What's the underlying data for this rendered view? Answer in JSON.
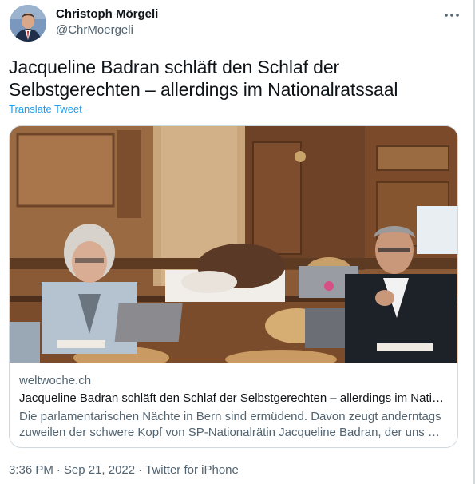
{
  "author": {
    "display_name": "Christoph Mörgeli",
    "handle": "@ChrMoergeli"
  },
  "tweet": {
    "text": "Jacqueline Badran schläft den Schlaf der Selbstgerechten – allerdings im Nationalratssaal",
    "translate_label": "Translate Tweet"
  },
  "card": {
    "domain": "weltwoche.ch",
    "title": "Jacqueline Badran schläft den Schlaf der Selbstgerechten – allerdings im Natio…",
    "description": "Die parlamentarischen Nächte in Bern sind ermüdend. Davon zeugt anderntags zuweilen der schwere Kopf von SP-Nationalrätin Jacqueline Badran, der uns …"
  },
  "meta": {
    "time": "3:36 PM",
    "separator": "·",
    "date": "Sep 21, 2022",
    "source": "Twitter for iPhone"
  },
  "icons": {
    "more": "more-horizontal-icon"
  },
  "colors": {
    "link": "#1d9bf0",
    "secondary_text": "#536471",
    "primary_text": "#0f1419",
    "border": "#cfd9de"
  }
}
